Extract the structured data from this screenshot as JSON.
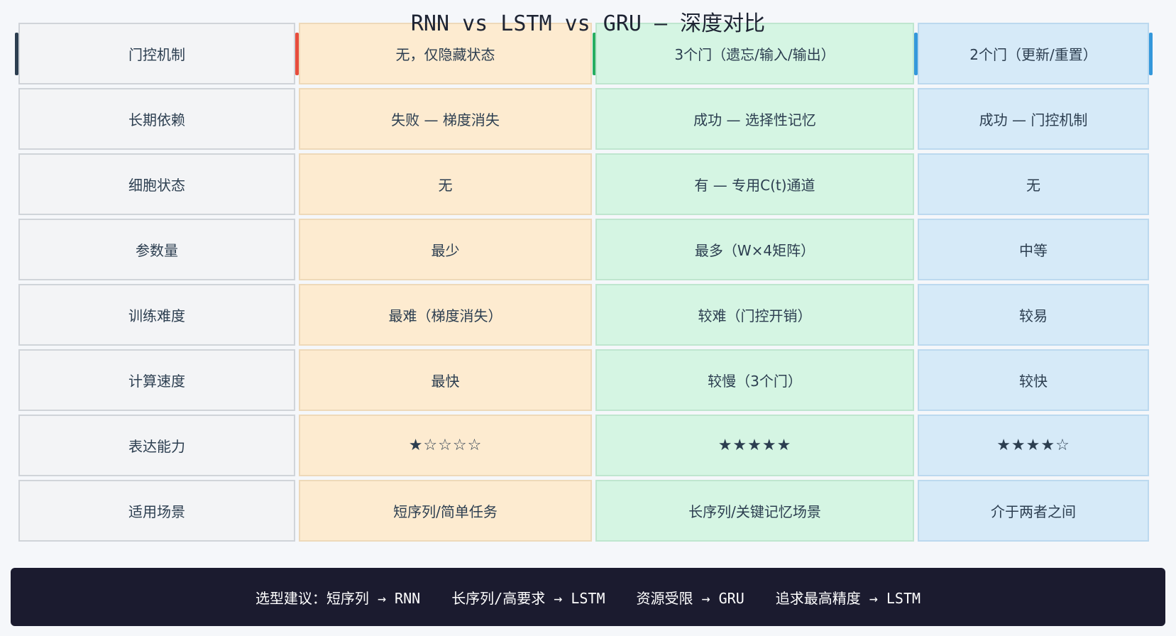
{
  "title": "RNN vs LSTM vs GRU — 深度对比",
  "rows": [
    [
      "门控机制",
      "无，仅隐藏状态",
      "3个门（遗忘/输入/输出）",
      "2个门（更新/重置）"
    ],
    [
      "长期依赖",
      "失败 — 梯度消失",
      "成功 — 选择性记忆",
      "成功 — 门控机制"
    ],
    [
      "细胞状态",
      "无",
      "有 — 专用C(t)通道",
      "无"
    ],
    [
      "参数量",
      "最少",
      "最多（W×4矩阵）",
      "中等"
    ],
    [
      "训练难度",
      "最难（梯度消失）",
      "较难（门控开销）",
      "较易"
    ],
    [
      "计算速度",
      "最快",
      "较慢（3个门）",
      "较快"
    ],
    [
      "表达能力",
      "★☆☆☆☆",
      "★★★★★",
      "★★★★☆"
    ],
    [
      "适用场景",
      "短序列/简单任务",
      "长序列/关键记忆场景",
      "介于两者之间"
    ]
  ],
  "footer": {
    "lead": "选型建议：",
    "items": [
      "短序列 → RNN",
      "长序列/高要求 → LSTM",
      "资源受限 → GRU",
      "追求最高精度 → LSTM"
    ]
  },
  "colors": {
    "rnn_accent": "#e74c3c",
    "lstm_accent": "#27ae60",
    "gru_accent": "#3498db",
    "label_accent": "#2c3e50",
    "footer_bg": "#1b1b2f"
  }
}
